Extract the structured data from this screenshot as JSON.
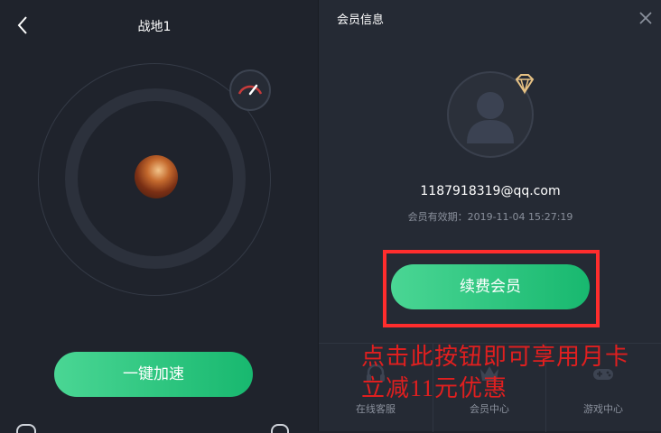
{
  "left_panel": {
    "game_title": "战地1",
    "boost_label": "一键加速",
    "icons": {
      "back": "chevron-left-icon",
      "speed": "speedometer-icon",
      "game": "game-avatar-icon"
    }
  },
  "member_panel": {
    "title": "会员信息",
    "email": "1187918319@qq.com",
    "expiry": "会员有效期：2019-11-04 15:27:19",
    "renew_label": "续费会员",
    "nav": [
      {
        "label": "在线客服",
        "icon": "headset-icon"
      },
      {
        "label": "会员中心",
        "icon": "crown-icon"
      },
      {
        "label": "游戏中心",
        "icon": "gamepad-icon"
      }
    ]
  },
  "annotation": {
    "line1": "点击此按钮即可享用月卡",
    "line2": "立减11元优惠"
  },
  "colors": {
    "accent_green": "#18b86f",
    "annotation_red": "#e01f1f",
    "background": "#1f232c"
  }
}
